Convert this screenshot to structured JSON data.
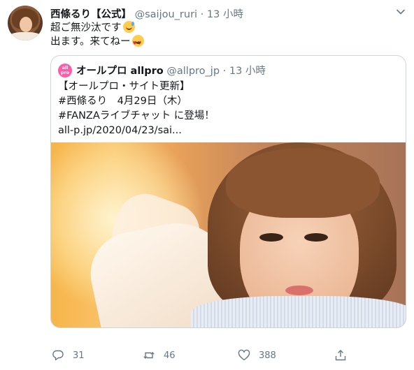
{
  "tweet": {
    "author_name": "西條るり【公式】",
    "handle": "@saijou_ruri",
    "separator": "·",
    "time": "13 小時",
    "line1": "超ご無沙汰です",
    "line2": "出ます。来てねー"
  },
  "quoted": {
    "avatar_text": "all pro",
    "author_name": "オールプロ allpro",
    "handle": "@allpro_jp",
    "separator": "·",
    "time": "13 小時",
    "lines": [
      "【オールプロ・サイト更新】",
      "#西條るり　4月29日（木）",
      "#FANZAライブチャット に登場！",
      "all-p.jp/2020/04/23/sai..."
    ]
  },
  "actions": {
    "reply_count": "31",
    "retweet_count": "46",
    "like_count": "388"
  },
  "icons": [
    "chevron-down-icon",
    "reply-icon",
    "retweet-icon",
    "like-icon",
    "share-icon",
    "smiling-sweat-emoji",
    "heart-eyes-emoji"
  ],
  "colors": {
    "secondary_text": "#657786",
    "border": "#ccd6dd",
    "quoted_avatar": "#ff5ca8"
  }
}
